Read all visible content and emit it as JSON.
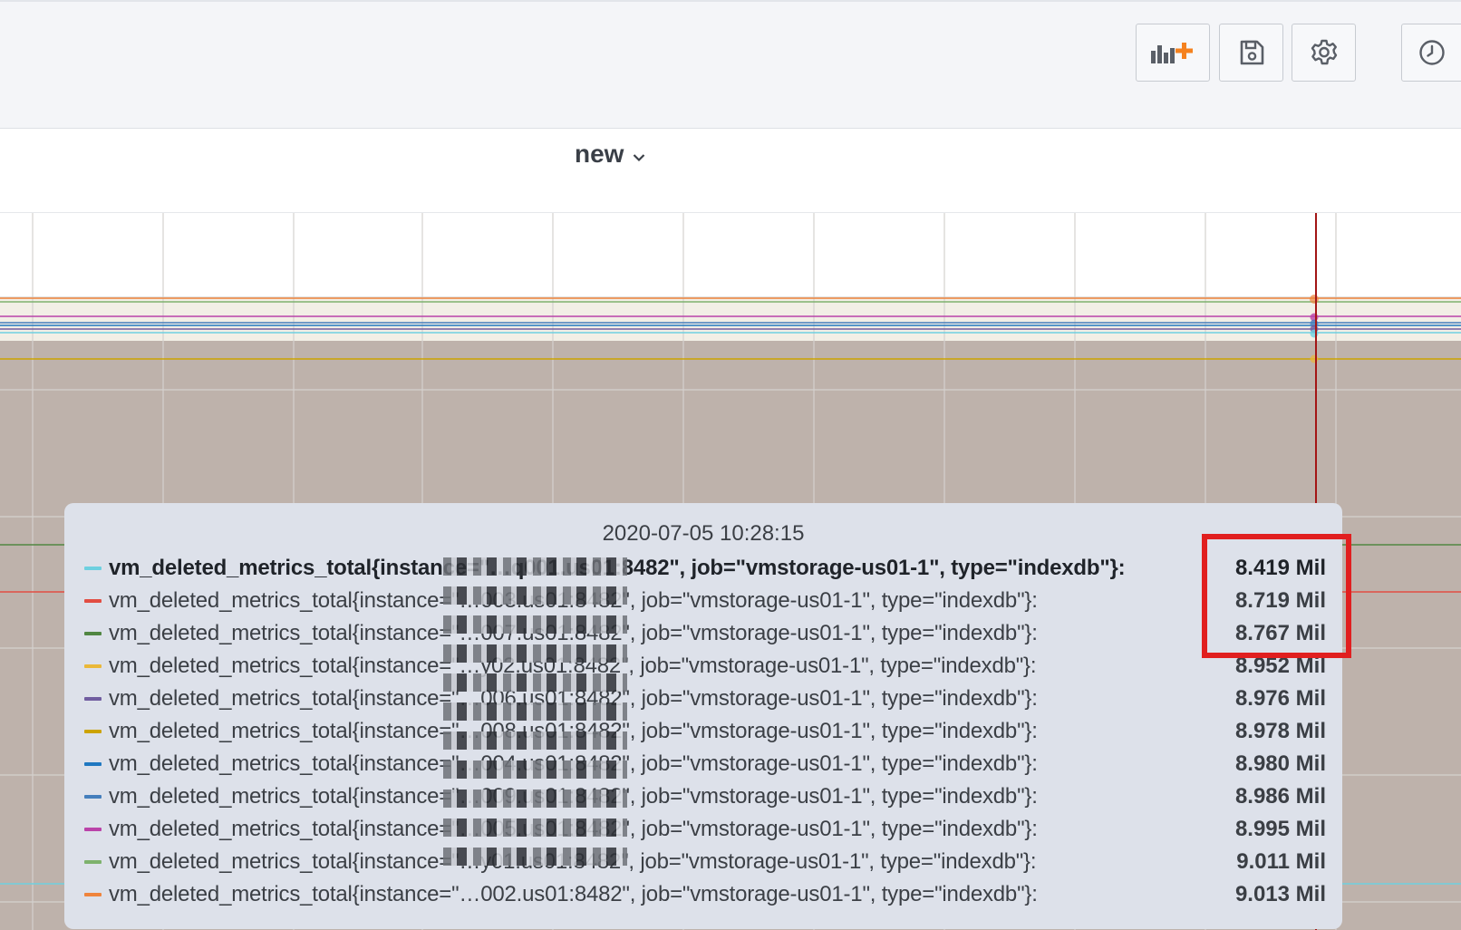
{
  "toolbar": {
    "add_panel_icon": "add-panel-icon",
    "save_icon": "save-icon",
    "settings_icon": "gear-icon",
    "time_picker_icon": "clock-icon"
  },
  "panel": {
    "title": "new"
  },
  "tooltip": {
    "timestamp": "2020-07-05 10:28:15",
    "rows": [
      {
        "label": "vm_deleted_metrics_total{instance=\"…q001.us01:8482\", job=\"vmstorage-us01-1\", type=\"indexdb\"}:",
        "value": "8.419 Mil",
        "color": "#6ed0e0",
        "highlighted": true
      },
      {
        "label": "vm_deleted_metrics_total{instance=\"…003.us01:8482\", job=\"vmstorage-us01-1\", type=\"indexdb\"}:",
        "value": "8.719 Mil",
        "color": "#e24d42",
        "highlighted": false
      },
      {
        "label": "vm_deleted_metrics_total{instance=\"…007.us01:8482\", job=\"vmstorage-us01-1\", type=\"indexdb\"}:",
        "value": "8.767 Mil",
        "color": "#508642",
        "highlighted": false
      },
      {
        "label": "vm_deleted_metrics_total{instance=\"…y02.us01:8482\", job=\"vmstorage-us01-1\", type=\"indexdb\"}:",
        "value": "8.952 Mil",
        "color": "#eab839",
        "highlighted": false
      },
      {
        "label": "vm_deleted_metrics_total{instance=\"…006.us01:8482\", job=\"vmstorage-us01-1\", type=\"indexdb\"}:",
        "value": "8.976 Mil",
        "color": "#705da0",
        "highlighted": false
      },
      {
        "label": "vm_deleted_metrics_total{instance=\"…008.us01:8482\", job=\"vmstorage-us01-1\", type=\"indexdb\"}:",
        "value": "8.978 Mil",
        "color": "#cca300",
        "highlighted": false
      },
      {
        "label": "vm_deleted_metrics_total{instance=\"…004.us01:8482\", job=\"vmstorage-us01-1\", type=\"indexdb\"}:",
        "value": "8.980 Mil",
        "color": "#1f78c1",
        "highlighted": false
      },
      {
        "label": "vm_deleted_metrics_total{instance=\"…009.us01:8482\", job=\"vmstorage-us01-1\", type=\"indexdb\"}:",
        "value": "8.986 Mil",
        "color": "#447ebc",
        "highlighted": false
      },
      {
        "label": "vm_deleted_metrics_total{instance=\"…005.us01:8482\", job=\"vmstorage-us01-1\", type=\"indexdb\"}:",
        "value": "8.995 Mil",
        "color": "#ba43a9",
        "highlighted": false
      },
      {
        "label": "vm_deleted_metrics_total{instance=\"…y01.us01:8482\", job=\"vmstorage-us01-1\", type=\"indexdb\"}:",
        "value": "9.011 Mil",
        "color": "#7eb26d",
        "highlighted": false
      },
      {
        "label": "vm_deleted_metrics_total{instance=\"…002.us01:8482\", job=\"vmstorage-us01-1\", type=\"indexdb\"}:",
        "value": "9.013 Mil",
        "color": "#ef843c",
        "highlighted": false
      }
    ]
  },
  "annotation": {
    "color": "#e11f1f"
  },
  "colors": {
    "area_fill": "#beb2ab",
    "area_fill_top": "#f2efe6",
    "cursor_line": "#a31515"
  }
}
